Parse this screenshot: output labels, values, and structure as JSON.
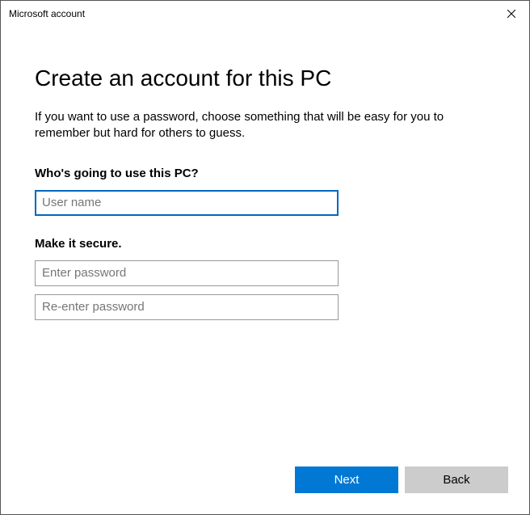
{
  "window": {
    "title": "Microsoft account"
  },
  "headings": {
    "title": "Create an account for this PC",
    "subtitle": "If you want to use a password, choose something that will be easy for you to remember but hard for others to guess."
  },
  "sections": {
    "user_label": "Who's going to use this PC?",
    "secure_label": "Make it secure."
  },
  "inputs": {
    "username": {
      "value": "",
      "placeholder": "User name"
    },
    "password": {
      "value": "",
      "placeholder": "Enter password"
    },
    "password_confirm": {
      "value": "",
      "placeholder": "Re-enter password"
    }
  },
  "buttons": {
    "next": "Next",
    "back": "Back"
  },
  "colors": {
    "accent": "#0078d4",
    "focus_border": "#0067c0",
    "secondary_btn": "#cccccc"
  }
}
